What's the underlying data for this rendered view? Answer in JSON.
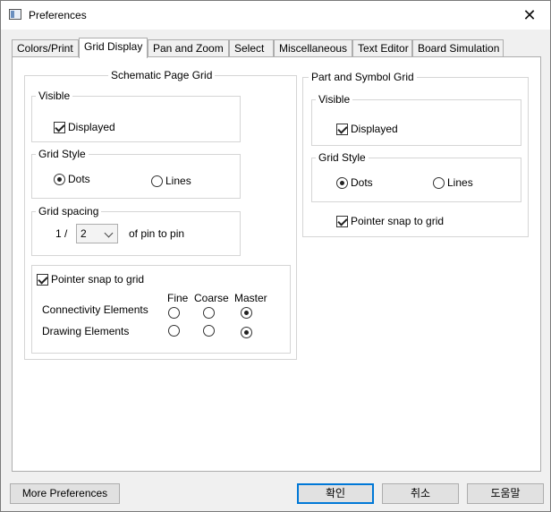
{
  "window": {
    "title": "Preferences"
  },
  "tabs": [
    "Colors/Print",
    "Grid Display",
    "Pan and Zoom",
    "Select",
    "Miscellaneous",
    "Text Editor",
    "Board Simulation"
  ],
  "schematic": {
    "title": "Schematic Page Grid",
    "visible": {
      "title": "Visible",
      "displayed_label": "Displayed",
      "displayed_checked": true
    },
    "grid_style": {
      "title": "Grid Style",
      "dots_label": "Dots",
      "lines_label": "Lines",
      "selected": "Dots"
    },
    "grid_spacing": {
      "title": "Grid spacing",
      "prefix": "1 /",
      "value": "2",
      "suffix": "of pin to pin"
    },
    "snap": {
      "label": "Pointer snap to grid",
      "checked": true,
      "columns": [
        "Fine",
        "Coarse",
        "Master"
      ],
      "rows": [
        {
          "label": "Connectivity Elements",
          "selected": "Master"
        },
        {
          "label": "Drawing Elements",
          "selected": "Master"
        }
      ]
    }
  },
  "part_symbol": {
    "title": "Part and Symbol Grid",
    "visible": {
      "title": "Visible",
      "displayed_label": "Displayed",
      "displayed_checked": true
    },
    "grid_style": {
      "title": "Grid Style",
      "dots_label": "Dots",
      "lines_label": "Lines",
      "selected": "Dots"
    },
    "snap_label": "Pointer snap to grid",
    "snap_checked": true
  },
  "buttons": {
    "more_preferences": "More Preferences",
    "ok": "확인",
    "cancel": "취소",
    "help": "도움말"
  }
}
